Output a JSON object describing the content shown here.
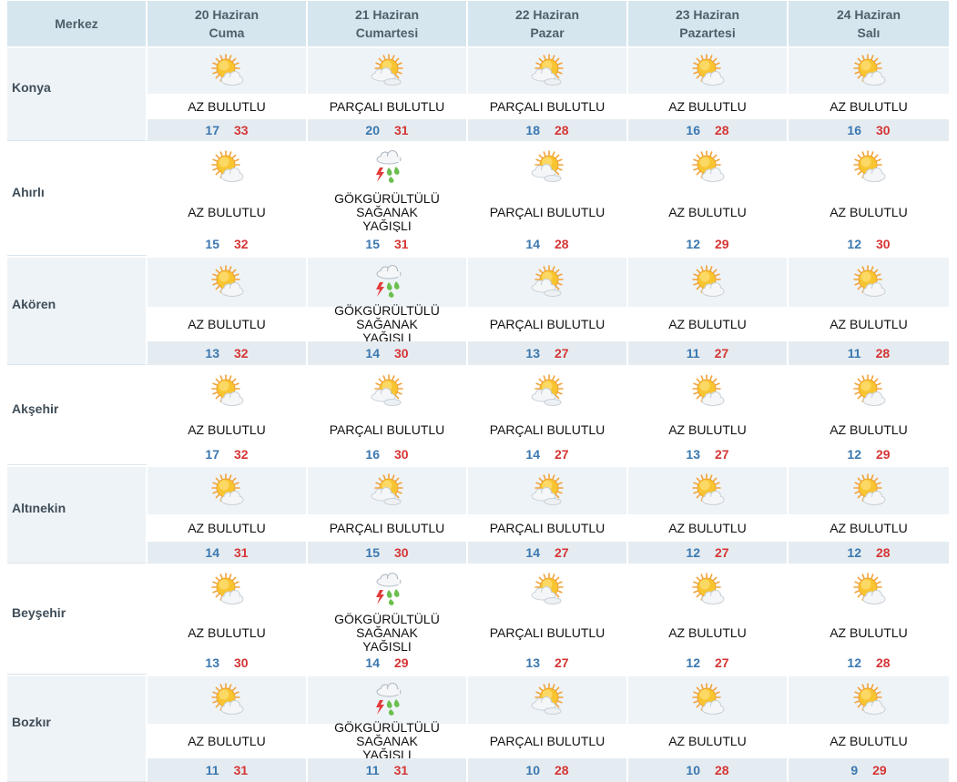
{
  "header": {
    "center_label": "Merkez",
    "days": [
      {
        "date": "20 Haziran",
        "weekday": "Cuma"
      },
      {
        "date": "21 Haziran",
        "weekday": "Cumartesi"
      },
      {
        "date": "22 Haziran",
        "weekday": "Pazar"
      },
      {
        "date": "23 Haziran",
        "weekday": "Pazartesi"
      },
      {
        "date": "24 Haziran",
        "weekday": "Salı"
      }
    ]
  },
  "colors": {
    "min_temp": "#3b78b0",
    "max_temp": "#d63535",
    "header_bg": "#d6e6ee"
  },
  "rows": [
    {
      "name": "Konya",
      "days": [
        {
          "icon": "partly-cloudy-sun-icon",
          "condition": "AZ BULUTLU",
          "min": "17",
          "max": "33"
        },
        {
          "icon": "mostly-cloudy-sun-icon",
          "condition": "PARÇALI BULUTLU",
          "min": "20",
          "max": "31"
        },
        {
          "icon": "mostly-cloudy-sun-icon",
          "condition": "PARÇALI BULUTLU",
          "min": "18",
          "max": "28"
        },
        {
          "icon": "partly-cloudy-sun-icon",
          "condition": "AZ BULUTLU",
          "min": "16",
          "max": "28"
        },
        {
          "icon": "partly-cloudy-sun-icon",
          "condition": "AZ BULUTLU",
          "min": "16",
          "max": "30"
        }
      ]
    },
    {
      "name": "Ahırlı",
      "days": [
        {
          "icon": "partly-cloudy-sun-icon",
          "condition": "AZ BULUTLU",
          "min": "15",
          "max": "32"
        },
        {
          "icon": "thunderstorm-rain-icon",
          "condition": "GÖKGÜRÜLTÜLÜ SAĞANAK YAĞIŞLI",
          "min": "15",
          "max": "31"
        },
        {
          "icon": "mostly-cloudy-sun-icon",
          "condition": "PARÇALI BULUTLU",
          "min": "14",
          "max": "28"
        },
        {
          "icon": "partly-cloudy-sun-icon",
          "condition": "AZ BULUTLU",
          "min": "12",
          "max": "29"
        },
        {
          "icon": "partly-cloudy-sun-icon",
          "condition": "AZ BULUTLU",
          "min": "12",
          "max": "30"
        }
      ]
    },
    {
      "name": "Akören",
      "days": [
        {
          "icon": "partly-cloudy-sun-icon",
          "condition": "AZ BULUTLU",
          "min": "13",
          "max": "32"
        },
        {
          "icon": "thunderstorm-rain-icon",
          "condition": "GÖKGÜRÜLTÜLÜ SAĞANAK YAĞIŞLI",
          "min": "14",
          "max": "30"
        },
        {
          "icon": "mostly-cloudy-sun-icon",
          "condition": "PARÇALI BULUTLU",
          "min": "13",
          "max": "27"
        },
        {
          "icon": "partly-cloudy-sun-icon",
          "condition": "AZ BULUTLU",
          "min": "11",
          "max": "27"
        },
        {
          "icon": "partly-cloudy-sun-icon",
          "condition": "AZ BULUTLU",
          "min": "11",
          "max": "28"
        }
      ]
    },
    {
      "name": "Akşehir",
      "days": [
        {
          "icon": "partly-cloudy-sun-icon",
          "condition": "AZ BULUTLU",
          "min": "17",
          "max": "32"
        },
        {
          "icon": "mostly-cloudy-sun-icon",
          "condition": "PARÇALI BULUTLU",
          "min": "16",
          "max": "30"
        },
        {
          "icon": "mostly-cloudy-sun-icon",
          "condition": "PARÇALI BULUTLU",
          "min": "14",
          "max": "27"
        },
        {
          "icon": "partly-cloudy-sun-icon",
          "condition": "AZ BULUTLU",
          "min": "13",
          "max": "27"
        },
        {
          "icon": "partly-cloudy-sun-icon",
          "condition": "AZ BULUTLU",
          "min": "12",
          "max": "29"
        }
      ]
    },
    {
      "name": "Altınekin",
      "days": [
        {
          "icon": "partly-cloudy-sun-icon",
          "condition": "AZ BULUTLU",
          "min": "14",
          "max": "31"
        },
        {
          "icon": "mostly-cloudy-sun-icon",
          "condition": "PARÇALI BULUTLU",
          "min": "15",
          "max": "30"
        },
        {
          "icon": "mostly-cloudy-sun-icon",
          "condition": "PARÇALI BULUTLU",
          "min": "14",
          "max": "27"
        },
        {
          "icon": "partly-cloudy-sun-icon",
          "condition": "AZ BULUTLU",
          "min": "12",
          "max": "27"
        },
        {
          "icon": "partly-cloudy-sun-icon",
          "condition": "AZ BULUTLU",
          "min": "12",
          "max": "28"
        }
      ]
    },
    {
      "name": "Beyşehir",
      "days": [
        {
          "icon": "partly-cloudy-sun-icon",
          "condition": "AZ BULUTLU",
          "min": "13",
          "max": "30"
        },
        {
          "icon": "thunderstorm-rain-icon",
          "condition": "GÖKGÜRÜLTÜLÜ SAĞANAK YAĞIŞLI",
          "min": "14",
          "max": "29"
        },
        {
          "icon": "mostly-cloudy-sun-icon",
          "condition": "PARÇALI BULUTLU",
          "min": "13",
          "max": "27"
        },
        {
          "icon": "partly-cloudy-sun-icon",
          "condition": "AZ BULUTLU",
          "min": "12",
          "max": "27"
        },
        {
          "icon": "partly-cloudy-sun-icon",
          "condition": "AZ BULUTLU",
          "min": "12",
          "max": "28"
        }
      ]
    },
    {
      "name": "Bozkır",
      "days": [
        {
          "icon": "partly-cloudy-sun-icon",
          "condition": "AZ BULUTLU",
          "min": "11",
          "max": "31"
        },
        {
          "icon": "thunderstorm-rain-icon",
          "condition": "GÖKGÜRÜLTÜLÜ SAĞANAK YAĞIŞLI",
          "min": "11",
          "max": "31"
        },
        {
          "icon": "mostly-cloudy-sun-icon",
          "condition": "PARÇALI BULUTLU",
          "min": "10",
          "max": "28"
        },
        {
          "icon": "partly-cloudy-sun-icon",
          "condition": "AZ BULUTLU",
          "min": "10",
          "max": "28"
        },
        {
          "icon": "partly-cloudy-sun-icon",
          "condition": "AZ BULUTLU",
          "min": "9",
          "max": "29"
        }
      ]
    }
  ]
}
